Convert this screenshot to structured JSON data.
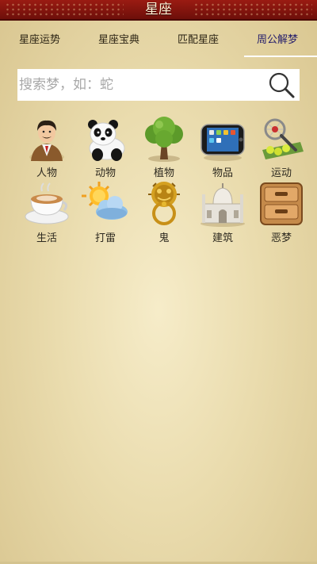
{
  "header": {
    "title": "星座"
  },
  "tabs": [
    {
      "label": "星座运势"
    },
    {
      "label": "星座宝典"
    },
    {
      "label": "匹配星座"
    },
    {
      "label": "周公解梦",
      "active": true
    }
  ],
  "search": {
    "placeholder": "搜索梦，如：蛇",
    "value": ""
  },
  "categories": [
    {
      "label": "人物",
      "icon": "person-icon"
    },
    {
      "label": "动物",
      "icon": "panda-icon"
    },
    {
      "label": "植物",
      "icon": "tree-icon"
    },
    {
      "label": "物品",
      "icon": "phone-icon"
    },
    {
      "label": "运动",
      "icon": "tennis-icon"
    },
    {
      "label": "生活",
      "icon": "coffee-cup-icon"
    },
    {
      "label": "打雷",
      "icon": "sun-cloud-icon"
    },
    {
      "label": "鬼",
      "icon": "door-knocker-icon"
    },
    {
      "label": "建筑",
      "icon": "palace-icon"
    },
    {
      "label": "恶梦",
      "icon": "drawer-cabinet-icon"
    }
  ],
  "colors": {
    "header": "#8b1a12",
    "active_tab": "#241d6b",
    "background": "#f1e4bb"
  }
}
